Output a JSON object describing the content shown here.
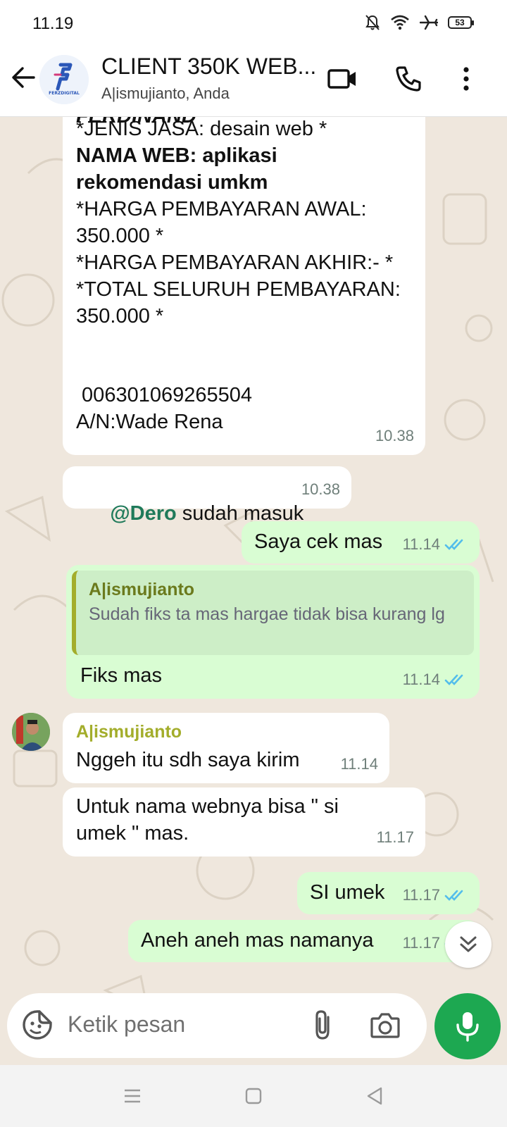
{
  "status_bar": {
    "time": "11.19",
    "battery": "53"
  },
  "header": {
    "title": "CLIENT 350K WEB...",
    "subtitle": "A|ismujianto, Anda",
    "logo_text": "FERZDIGITAL"
  },
  "messages": {
    "m1": {
      "partial_top": "FERDINAND",
      "line1": "*JENIS JASA: desain web *",
      "line2": "NAMA WEB: aplikasi",
      "line3": "rekomendasi umkm",
      "line4": "*HARGA PEMBAYARAN AWAL:",
      "line5": "350.000 *",
      "line6": "*HARGA PEMBAYARAN AKHIR:- *",
      "line7": "*TOTAL SELURUH PEMBAYARAN:",
      "line8": "350.000 *",
      "line9": " 006301069265504",
      "line10": "A/N:Wade Rena",
      "time": "10.38"
    },
    "m2": {
      "mention": "@Dero",
      "text": " sudah masuk",
      "time": "10.38"
    },
    "m3": {
      "text": "Saya cek mas",
      "time": "11.14"
    },
    "m4": {
      "quote_author": "A|ismujianto",
      "quote_text": "Sudah fiks ta mas hargae tidak bisa kurang lg",
      "text": "Fiks mas",
      "time": "11.14"
    },
    "m5": {
      "author": "A|ismujianto",
      "text": "Nggeh itu sdh saya kirim",
      "time": "11.14"
    },
    "m6": {
      "line1": "Untuk nama webnya bisa \" si",
      "line2": "umek \" mas.",
      "time": "11.17"
    },
    "m7": {
      "text": "SI umek",
      "time": "11.17"
    },
    "m8": {
      "text": "Aneh aneh mas namanya",
      "time": "11.17"
    }
  },
  "input": {
    "placeholder": "Ketik pesan"
  },
  "colors": {
    "outgoing": "#d9fdd3",
    "incoming": "#ffffff",
    "accent": "#1da851",
    "mention": "#1f7a5a",
    "author": "#a3ad2b",
    "read_ticks": "#53bdeb"
  }
}
